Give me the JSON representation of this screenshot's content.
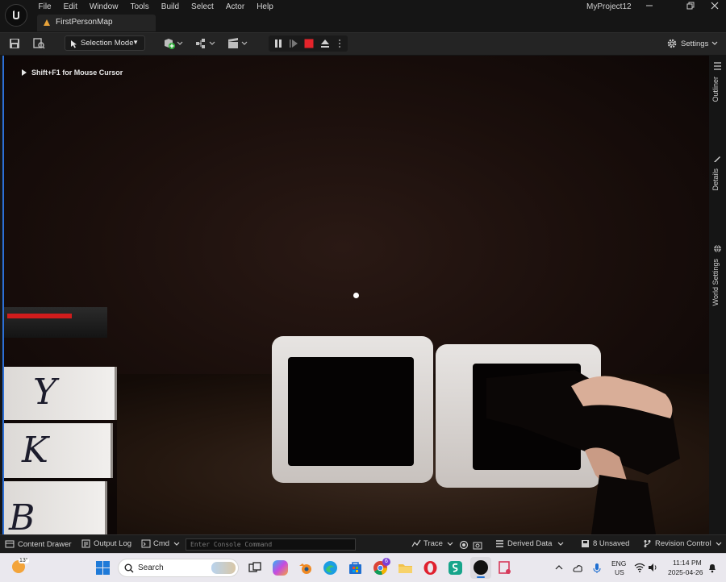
{
  "title_bar": {
    "menu": [
      "File",
      "Edit",
      "Window",
      "Tools",
      "Build",
      "Select",
      "Actor",
      "Help"
    ],
    "map_tab": "FirstPersonMap",
    "project_name": "MyProject12"
  },
  "toolbar": {
    "selection_mode": "Selection Mode",
    "settings": "Settings"
  },
  "viewport": {
    "hint": "Shift+F1 for Mouse Cursor",
    "letters": [
      "Y",
      "K",
      "B"
    ]
  },
  "side_panel": {
    "tabs": [
      "Outliner",
      "Details",
      "World Settings"
    ]
  },
  "status_bar": {
    "content_drawer": "Content Drawer",
    "output_log": "Output Log",
    "cmd": "Cmd",
    "console_placeholder": "Enter Console Command",
    "trace": "Trace",
    "derived_data": "Derived Data",
    "unsaved": "8 Unsaved",
    "revision_control": "Revision Control"
  },
  "taskbar": {
    "weather_temp": "13°",
    "search": "Search",
    "chrome_badge": "6",
    "language": "ENG",
    "region": "US",
    "time": "11:14 PM",
    "date": "2025-04-26"
  },
  "colors": {
    "ue_panel": "#242424",
    "ue_background": "#151515",
    "viewport_border": "#2c6fd6",
    "stop_red": "#e5242b",
    "taskbar": "#eae8ee"
  }
}
